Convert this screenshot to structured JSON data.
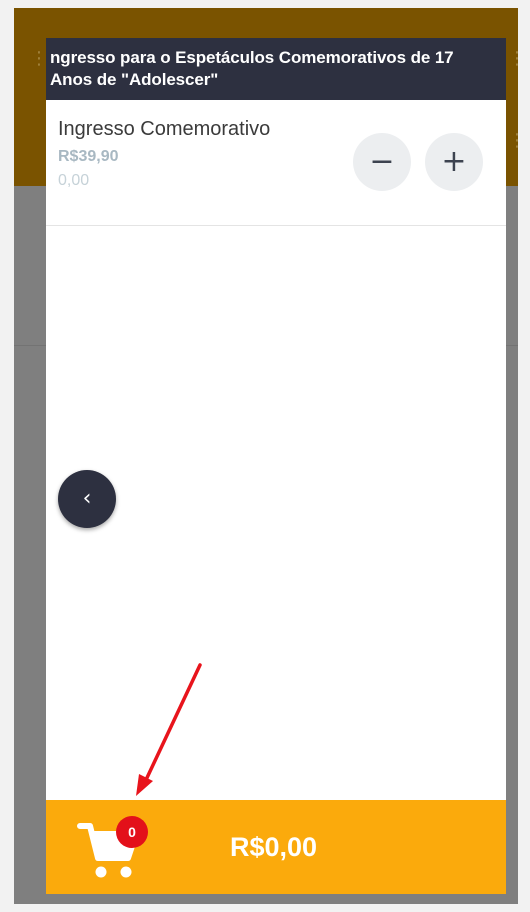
{
  "modal": {
    "title": "ngresso para o Espetáculos Comemorativos de 17 Anos de \"Adolescer\"",
    "item": {
      "name": "Ingresso Comemorativo",
      "price": "R$39,90",
      "subtotal": "0,00",
      "minus_label": "−",
      "plus_label": "+"
    },
    "back_label": "‹",
    "footer": {
      "cart_count": "0",
      "total": "R$0,00"
    }
  },
  "colors": {
    "header_bg": "#2d3040",
    "footer_bg": "#fbaa0c",
    "badge_bg": "#e3101a",
    "arrow": "#e8141c"
  },
  "icons": [
    "cart-icon",
    "minus-icon",
    "plus-icon",
    "chevron-left-icon",
    "more-vertical-icon"
  ]
}
